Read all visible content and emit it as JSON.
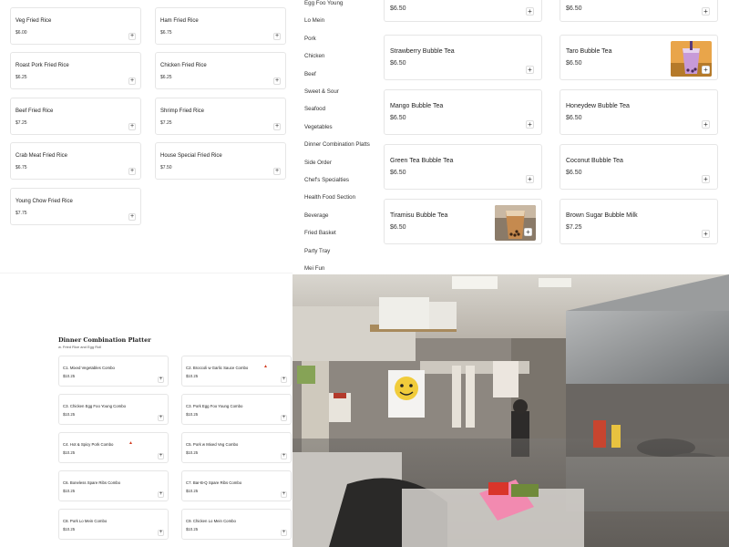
{
  "fried_rice": [
    {
      "name": "Veg Fried Rice",
      "price": "$6.00"
    },
    {
      "name": "Ham Fried Rice",
      "price": "$6.75"
    },
    {
      "name": "Roast Pork Fried Rice",
      "price": "$6.25"
    },
    {
      "name": "Chicken Fried Rice",
      "price": "$6.25"
    },
    {
      "name": "Beef Fried Rice",
      "price": "$7.25"
    },
    {
      "name": "Shrimp Fried Rice",
      "price": "$7.25"
    },
    {
      "name": "Crab Meat Fried Rice",
      "price": "$6.75"
    },
    {
      "name": "House Special Fried Rice",
      "price": "$7.50"
    },
    {
      "name": "Young Chow Fried Rice",
      "price": "$7.75"
    }
  ],
  "categories": [
    "Egg Foo Young",
    "Lo Mein",
    "Pork",
    "Chicken",
    "Beef",
    "Sweet & Sour",
    "Seafood",
    "Vegetables",
    "Dinner Combination Platts",
    "Side Order",
    "Chef's Specialties",
    "Health Food Section",
    "Beverage",
    "Fried Basket",
    "Party Tray",
    "Mei Fun"
  ],
  "bubble_tea": {
    "top_prices": [
      "$6.50",
      "$6.50"
    ],
    "items": [
      {
        "name": "Strawberry Bubble Tea",
        "price": "$6.50"
      },
      {
        "name": "Taro Bubble Tea",
        "price": "$6.50"
      },
      {
        "name": "Mango Bubble Tea",
        "price": "$6.50"
      },
      {
        "name": "Honeydew Bubble Tea",
        "price": "$6.50"
      },
      {
        "name": "Green Tea Bubble Tea",
        "price": "$6.50"
      },
      {
        "name": "Coconut Bubble Tea",
        "price": "$6.50"
      },
      {
        "name": "Tiramisu Bubble Tea",
        "price": "$6.50"
      },
      {
        "name": "Brown Sugar Bubble Milk",
        "price": "$7.25"
      }
    ]
  },
  "combo": {
    "title": "Dinner Combination Platter",
    "subtitle": "w. Fried Rice and Egg Roll",
    "items": [
      {
        "name": "C1. Mixed Vegetables Combo",
        "price": "$10.25"
      },
      {
        "name": "C2. Broccoli w Garlic Sauce Combo",
        "price": "$10.25"
      },
      {
        "name": "C3. Chicken Egg Foo Young Combo",
        "price": "$10.25"
      },
      {
        "name": "C3. Pork Egg Foo Young Combo",
        "price": "$10.25"
      },
      {
        "name": "C4. Hot & Spicy Pork Combo",
        "price": "$10.25"
      },
      {
        "name": "C5. Pork w Mixed Veg Combo",
        "price": "$10.25"
      },
      {
        "name": "C6. Boneless Spare Ribs Combo",
        "price": "$10.25"
      },
      {
        "name": "C7. Bar-B-Q Spare Ribs Combo",
        "price": "$10.25"
      },
      {
        "name": "C8. Pork Lo Mein Combo",
        "price": "$10.25"
      },
      {
        "name": "C9. Chicken Lo Mein Combo",
        "price": "$10.25"
      }
    ]
  },
  "icons": {
    "add": "plus-icon",
    "spicy": "chili-pepper-icon"
  },
  "glyphs": {
    "plus": "+",
    "chili": "▲"
  },
  "colors": {
    "accent_spicy": "#d23a1e",
    "card_border": "#e6e6e6",
    "text": "#222222"
  }
}
